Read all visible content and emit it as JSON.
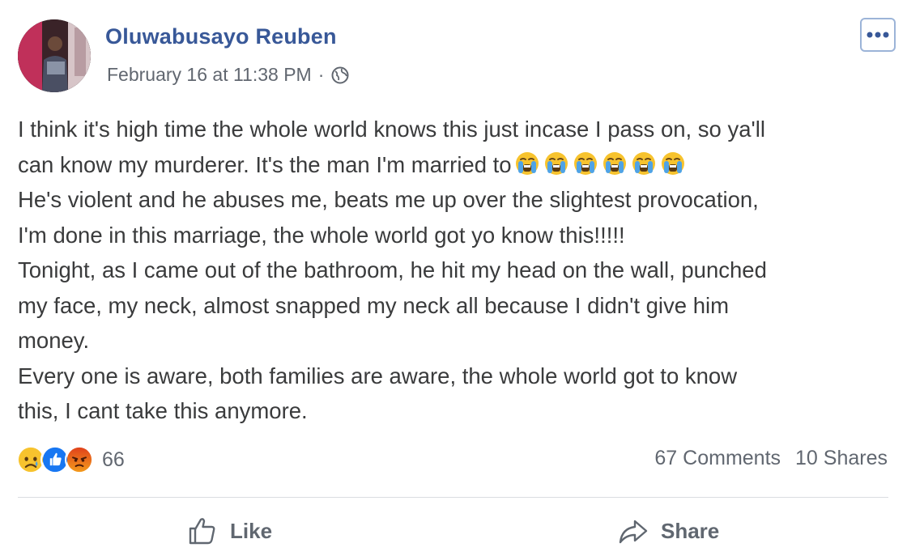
{
  "post": {
    "author": "Oluwabusayo Reuben",
    "timestamp": "February 16 at 11:38 PM",
    "separator": "·",
    "privacy_icon": "globe-icon",
    "more_icon": "more-options-icon",
    "lines": [
      "I think it's high time the whole world knows this just incase I pass on, so ya'll",
      "can know my murderer. It's the man I'm married to",
      "He's violent and he abuses me, beats me up over the slightest provocation,",
      "I'm done in this marriage, the whole world got yo know this!!!!!",
      "Tonight, as I came out of the bathroom, he hit my head on the wall, punched",
      "my face, my neck, almost snapped my neck all because I didn't give him",
      "money.",
      "Every one is aware, both families are aware, the whole world got to know",
      "this, I cant take this anymore."
    ],
    "inline_emoji": "loudly-crying-face",
    "inline_emoji_count": 6
  },
  "reactions": {
    "icons": [
      "sad-reaction-icon",
      "like-reaction-icon",
      "angry-reaction-icon"
    ],
    "count": "66"
  },
  "stats": {
    "comments": "67 Comments",
    "shares": "10 Shares"
  },
  "actions": {
    "like_label": "Like",
    "share_label": "Share"
  },
  "colors": {
    "author_link": "#385898",
    "meta_text": "#616770",
    "body_text": "#3a3b3c",
    "divider": "#dadde1",
    "like_blue": "#1877f2",
    "angry_orange": "#e9710f",
    "emoji_yellow": "#f7c32e"
  }
}
